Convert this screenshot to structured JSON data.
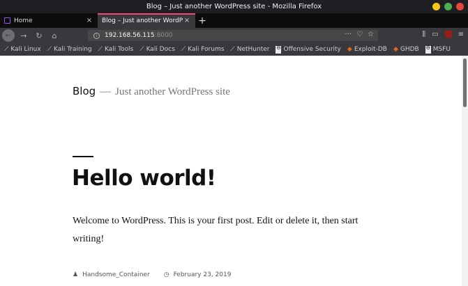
{
  "window": {
    "title": "Blog – Just another WordPress site - Mozilla Firefox",
    "controls": {
      "minimize_color": "#f5c518",
      "maximize_color": "#4caf50",
      "close_color": "#e8453c"
    }
  },
  "tabs": [
    {
      "label": "Home",
      "active": false,
      "close": "×"
    },
    {
      "label": "Blog – Just another WordPre",
      "active": true,
      "close": "×"
    }
  ],
  "new_tab": "+",
  "navbar": {
    "back_icon": "arrow-left-icon",
    "forward": "→",
    "reload": "↻",
    "home": "⌂",
    "url_host": "192.168.56.115",
    "url_port": ":8000",
    "page_actions": "···",
    "pocket": "♡",
    "bookmark_star": "☆",
    "library": "⫼",
    "sidebar": "▭",
    "menu": "≡"
  },
  "bookmarks": [
    {
      "label": "Kali Linux",
      "icon": "kali-dragon-icon"
    },
    {
      "label": "Kali Training",
      "icon": "kali-dragon-icon"
    },
    {
      "label": "Kali Tools",
      "icon": "kali-dragon-icon"
    },
    {
      "label": "Kali Docs",
      "icon": "kali-dragon-icon"
    },
    {
      "label": "Kali Forums",
      "icon": "kali-dragon-icon"
    },
    {
      "label": "NetHunter",
      "icon": "kali-dragon-icon"
    },
    {
      "label": "Offensive Security",
      "icon": "offsec-icon"
    },
    {
      "label": "Exploit-DB",
      "icon": "exploit-db-icon"
    },
    {
      "label": "GHDB",
      "icon": "exploit-db-icon"
    },
    {
      "label": "MSFU",
      "icon": "offsec-icon"
    }
  ],
  "site": {
    "title": "Blog",
    "dash": "—",
    "description": "Just another WordPress site"
  },
  "post": {
    "title": "Hello world!",
    "body": "Welcome to WordPress. This is your first post. Edit or delete it, then start writing!",
    "author": "Handsome_Container",
    "date": "February 23, 2019"
  }
}
